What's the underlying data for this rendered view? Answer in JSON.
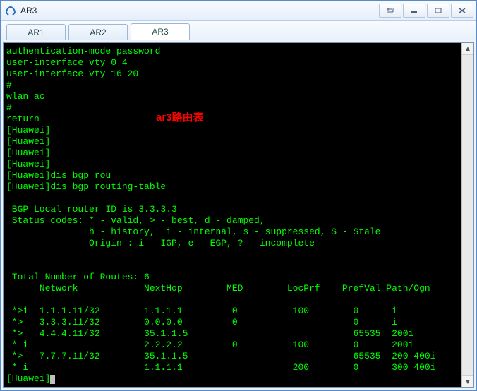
{
  "window": {
    "title": "AR3"
  },
  "tabs": [
    {
      "label": "AR1",
      "active": false
    },
    {
      "label": "AR2",
      "active": false
    },
    {
      "label": "AR3",
      "active": true
    }
  ],
  "overlay": {
    "text": "ar3路由表"
  },
  "terminal": {
    "preamble": [
      "authentication-mode password",
      "user-interface vty 0 4",
      "user-interface vty 16 20",
      "#",
      "wlan ac",
      "#",
      "return",
      "[Huawei]",
      "[Huawei]",
      "[Huawei]",
      "[Huawei]",
      "[Huawei]dis bgp rou",
      "[Huawei]dis bgp routing-table",
      ""
    ],
    "bgp_header": [
      " BGP Local router ID is 3.3.3.3",
      " Status codes: * - valid, > - best, d - damped,",
      "               h - history,  i - internal, s - suppressed, S - Stale",
      "               Origin : i - IGP, e - EGP, ? - incomplete",
      "",
      ""
    ],
    "routes_title": " Total Number of Routes: 6",
    "columns": "      Network            NextHop        MED        LocPrf    PrefVal Path/Ogn",
    "routes": [
      " *>i  1.1.1.11/32        1.1.1.1         0          100        0      i",
      " *>   3.3.3.11/32        0.0.0.0         0                     0      i",
      " *>   4.4.4.11/32        35.1.1.5                              65535  200i",
      " * i                     2.2.2.2         0          100        0      200i",
      " *>   7.7.7.11/32        35.1.1.5                              65535  200 400i",
      " * i                     1.1.1.1                    200        0      300 400i"
    ],
    "prompt": "[Huawei]"
  },
  "chart_data": {
    "type": "table",
    "title": "BGP routing-table (Local router ID 3.3.3.3)",
    "total_routes": 6,
    "columns": [
      "Status",
      "Network",
      "NextHop",
      "MED",
      "LocPrf",
      "PrefVal",
      "Path/Ogn"
    ],
    "rows": [
      [
        "*>i",
        "1.1.1.11/32",
        "1.1.1.1",
        0,
        100,
        0,
        "i"
      ],
      [
        "*>",
        "3.3.3.11/32",
        "0.0.0.0",
        0,
        null,
        0,
        "i"
      ],
      [
        "*>",
        "4.4.4.11/32",
        "35.1.1.5",
        null,
        null,
        65535,
        "200i"
      ],
      [
        "* i",
        "",
        "2.2.2.2",
        0,
        100,
        0,
        "200i"
      ],
      [
        "*>",
        "7.7.7.11/32",
        "35.1.1.5",
        null,
        null,
        65535,
        "200 400i"
      ],
      [
        "* i",
        "",
        "1.1.1.1",
        null,
        200,
        0,
        "300 400i"
      ]
    ]
  }
}
